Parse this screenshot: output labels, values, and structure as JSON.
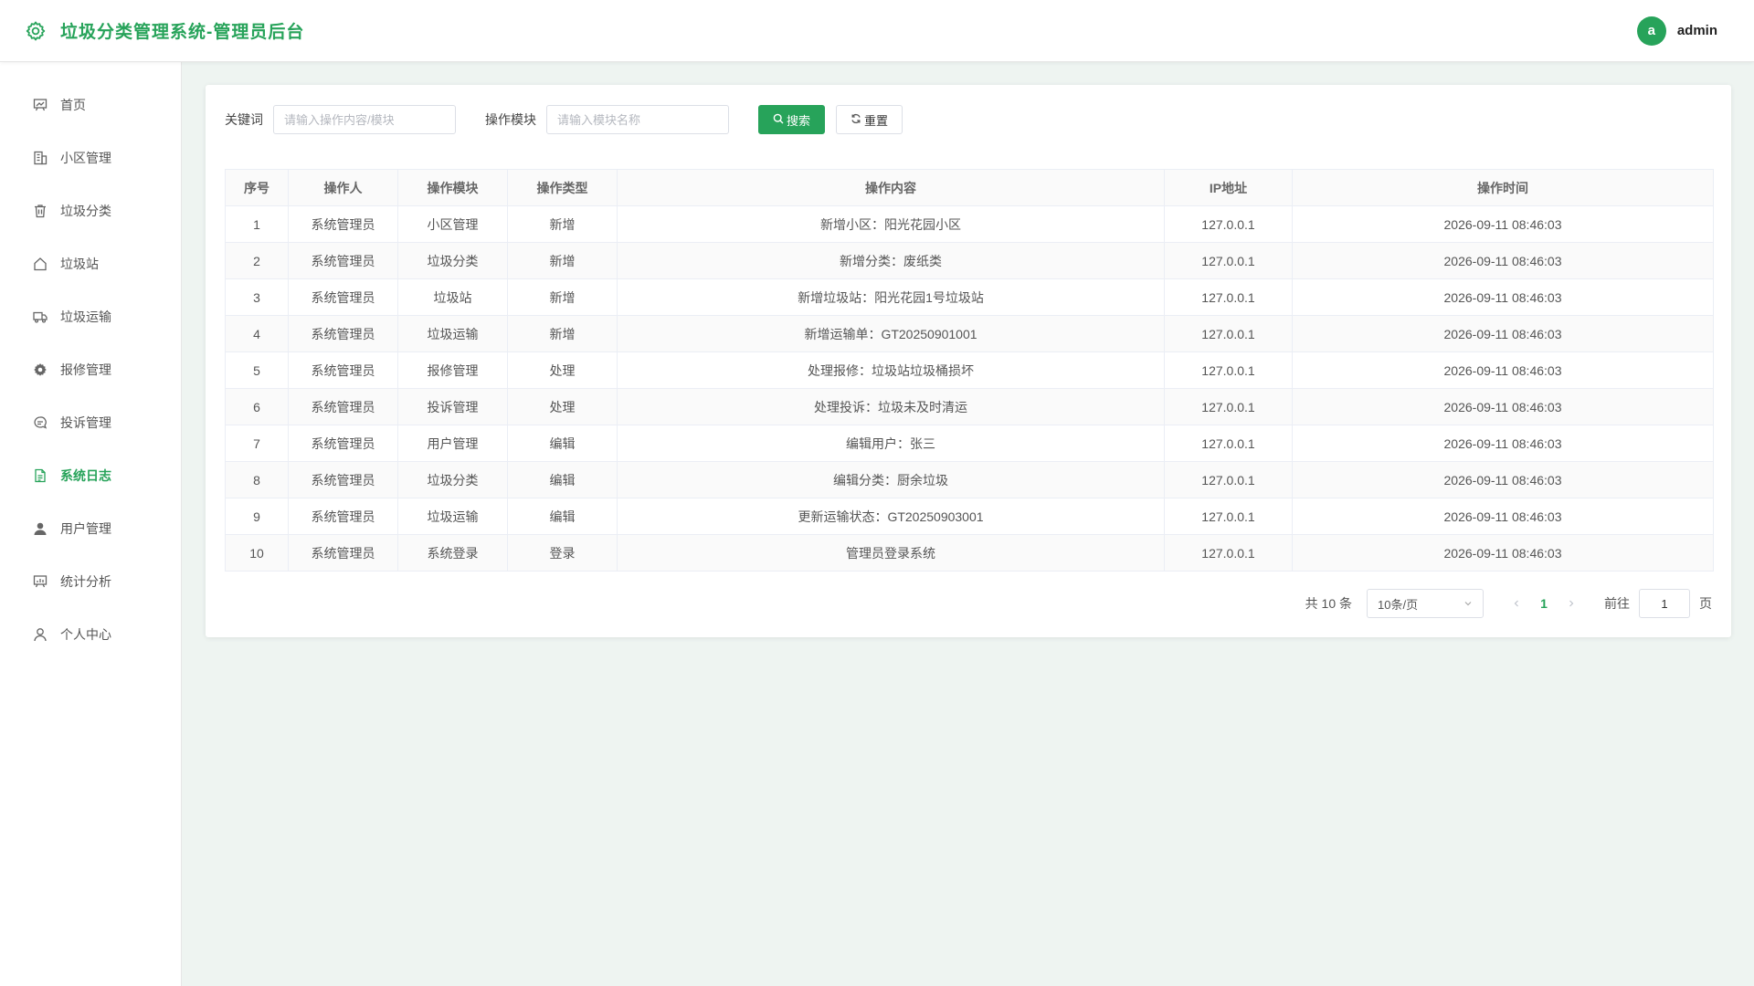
{
  "app": {
    "title": "垃圾分类管理系统-管理员后台",
    "brand_icon": "gear-icon",
    "accent_color": "#27a35a"
  },
  "user": {
    "avatar_letter": "a",
    "name": "admin"
  },
  "sidebar": {
    "items": [
      {
        "label": "首页",
        "icon": "presentation-board-icon"
      },
      {
        "label": "小区管理",
        "icon": "office-building-icon"
      },
      {
        "label": "垃圾分类",
        "icon": "trash-bin-icon"
      },
      {
        "label": "垃圾站",
        "icon": "house-icon"
      },
      {
        "label": "垃圾运输",
        "icon": "truck-icon"
      },
      {
        "label": "报修管理",
        "icon": "gear-icon"
      },
      {
        "label": "投诉管理",
        "icon": "chat-bubble-icon"
      },
      {
        "label": "系统日志",
        "icon": "document-icon",
        "active": true
      },
      {
        "label": "用户管理",
        "icon": "user-filled-icon"
      },
      {
        "label": "统计分析",
        "icon": "chart-board-icon"
      },
      {
        "label": "个人中心",
        "icon": "user-outline-icon"
      }
    ]
  },
  "search": {
    "keyword_label": "关键词",
    "keyword_placeholder": "请输入操作内容/模块",
    "keyword_value": "",
    "module_label": "操作模块",
    "module_placeholder": "请输入模块名称",
    "module_value": "",
    "search_button": "搜索",
    "reset_button": "重置"
  },
  "table": {
    "headers": [
      "序号",
      "操作人",
      "操作模块",
      "操作类型",
      "操作内容",
      "IP地址",
      "操作时间"
    ],
    "rows": [
      [
        "1",
        "系统管理员",
        "小区管理",
        "新增",
        "新增小区：阳光花园小区",
        "127.0.0.1",
        "2026-09-11 08:46:03"
      ],
      [
        "2",
        "系统管理员",
        "垃圾分类",
        "新增",
        "新增分类：废纸类",
        "127.0.0.1",
        "2026-09-11 08:46:03"
      ],
      [
        "3",
        "系统管理员",
        "垃圾站",
        "新增",
        "新增垃圾站：阳光花园1号垃圾站",
        "127.0.0.1",
        "2026-09-11 08:46:03"
      ],
      [
        "4",
        "系统管理员",
        "垃圾运输",
        "新增",
        "新增运输单：GT20250901001",
        "127.0.0.1",
        "2026-09-11 08:46:03"
      ],
      [
        "5",
        "系统管理员",
        "报修管理",
        "处理",
        "处理报修：垃圾站垃圾桶损坏",
        "127.0.0.1",
        "2026-09-11 08:46:03"
      ],
      [
        "6",
        "系统管理员",
        "投诉管理",
        "处理",
        "处理投诉：垃圾未及时清运",
        "127.0.0.1",
        "2026-09-11 08:46:03"
      ],
      [
        "7",
        "系统管理员",
        "用户管理",
        "编辑",
        "编辑用户：张三",
        "127.0.0.1",
        "2026-09-11 08:46:03"
      ],
      [
        "8",
        "系统管理员",
        "垃圾分类",
        "编辑",
        "编辑分类：厨余垃圾",
        "127.0.0.1",
        "2026-09-11 08:46:03"
      ],
      [
        "9",
        "系统管理员",
        "垃圾运输",
        "编辑",
        "更新运输状态：GT20250903001",
        "127.0.0.1",
        "2026-09-11 08:46:03"
      ],
      [
        "10",
        "系统管理员",
        "系统登录",
        "登录",
        "管理员登录系统",
        "127.0.0.1",
        "2026-09-11 08:46:03"
      ]
    ]
  },
  "pagination": {
    "total_text": "共 10 条",
    "page_size": "10条/页",
    "current_page": "1",
    "goto_label": "前往",
    "goto_value": "1",
    "goto_suffix": "页"
  }
}
